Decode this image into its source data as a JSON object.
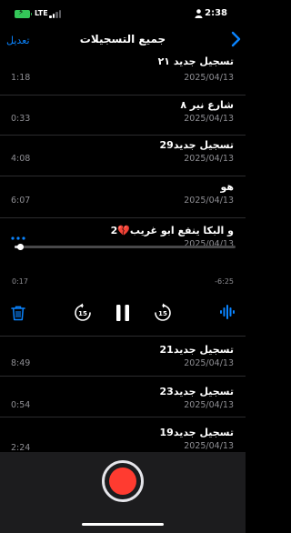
{
  "status_bar": {
    "network": "LTE",
    "time": "2:38"
  },
  "nav": {
    "edit_label": "تعديل",
    "title": "جميع التسجيلات"
  },
  "recordings_top": [
    {
      "title": "تسجيل جديد ٢١",
      "date": "2025/04/13",
      "duration": "1:18"
    },
    {
      "title": "شارع نير ٨",
      "date": "2025/04/13",
      "duration": "0:33"
    },
    {
      "title": "تسجيل جديد29",
      "date": "2025/04/13",
      "duration": "4:08"
    },
    {
      "title": "هو",
      "date": "2025/04/13",
      "duration": "6:07"
    }
  ],
  "expanded": {
    "title": "و البكا ينفع ابو غريب💔2",
    "date": "2025/04/13",
    "elapsed": "0:17",
    "remaining": "-6:25",
    "progress_fraction": 0.026,
    "skip_back_seconds": "15",
    "skip_forward_seconds": "15"
  },
  "recordings_bottom": [
    {
      "title": "تسجيل جديد21",
      "date": "2025/04/13",
      "duration": "8:49"
    },
    {
      "title": "تسجيل جديد23",
      "date": "2025/04/13",
      "duration": "0:54"
    },
    {
      "title": "تسجيل جديد19",
      "date": "2025/04/13",
      "duration": "2:24"
    }
  ],
  "colors": {
    "accent": "#0a84ff",
    "record": "#ff3b30",
    "battery": "#34c759"
  }
}
